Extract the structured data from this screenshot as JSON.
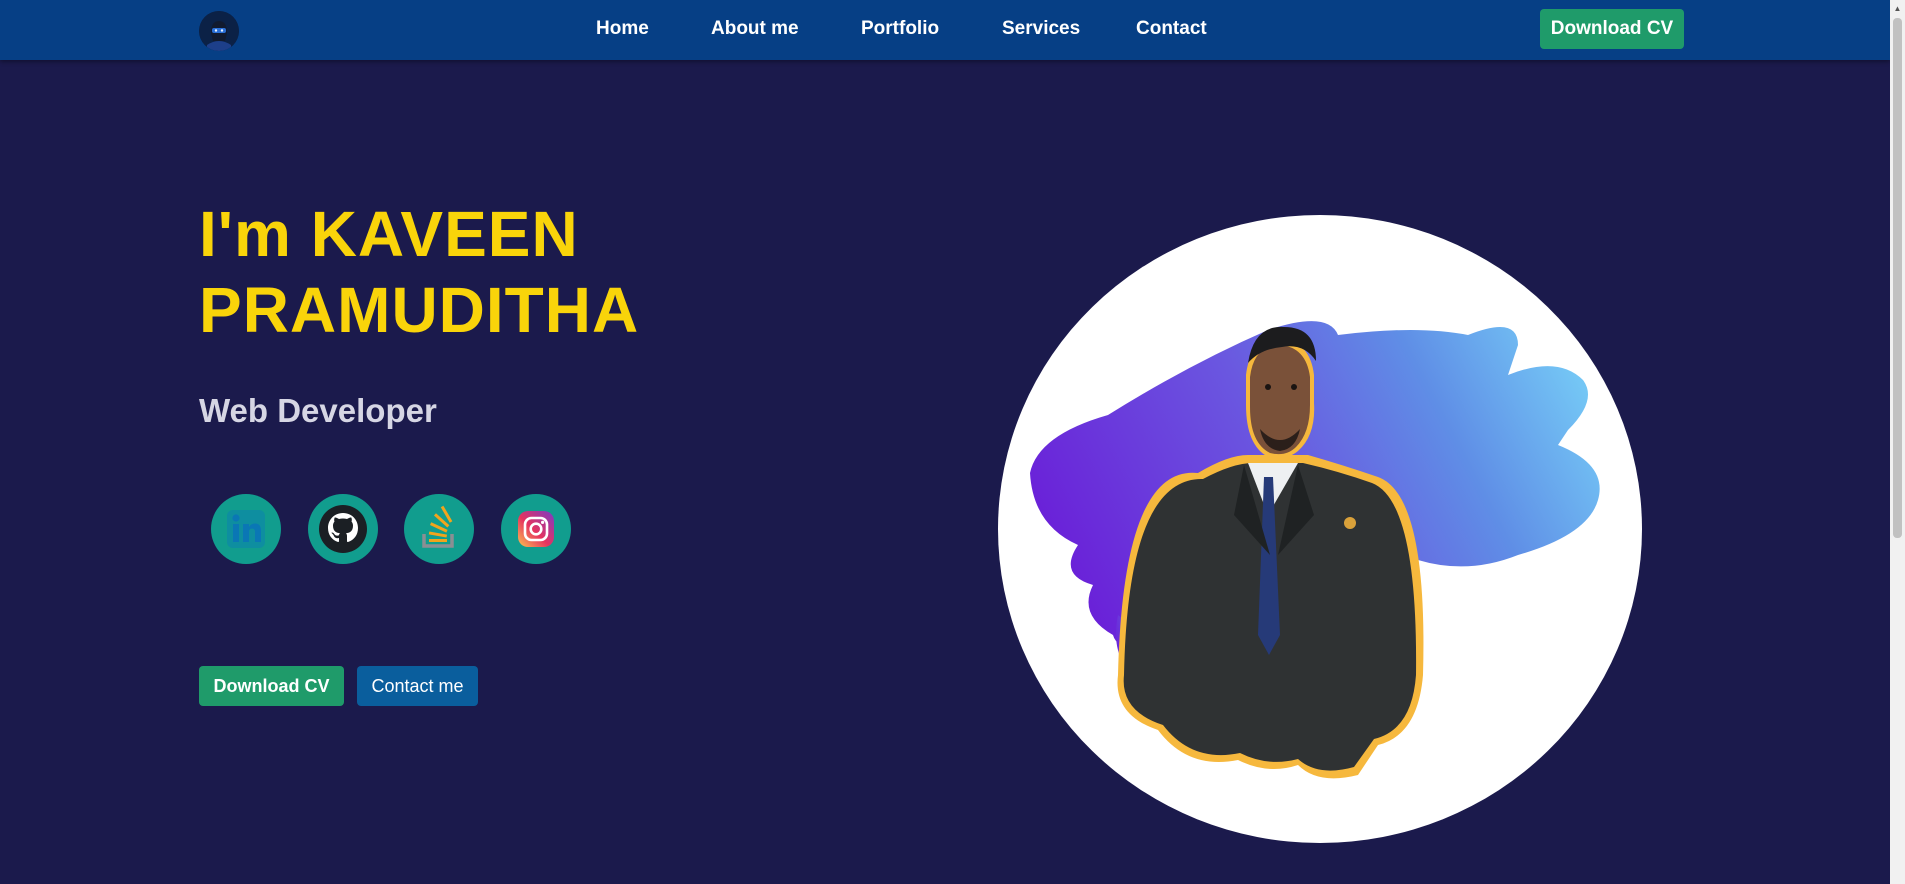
{
  "nav": {
    "logo_icon": "ninja-avatar-icon",
    "links": [
      "Home",
      "About me",
      "Portfolio",
      "Services",
      "Contact"
    ],
    "download_label": "Download CV"
  },
  "hero": {
    "name_line1": "I'm KAVEEN",
    "name_line2": "PRAMUDITHA",
    "role": "Web Developer",
    "social_icons": [
      "linkedin-icon",
      "github-icon",
      "stackoverflow-icon",
      "instagram-icon"
    ],
    "download_label": "Download CV",
    "contact_label": "Contact me"
  },
  "photo": {
    "icon": "profile-photo"
  },
  "colors": {
    "background": "#1b1a4c",
    "navbar": "#063f85",
    "accent_yellow": "#f9d40a",
    "button_green": "#1f9b6a",
    "button_blue": "#0a5e9d",
    "social_teal": "#119d8e"
  }
}
